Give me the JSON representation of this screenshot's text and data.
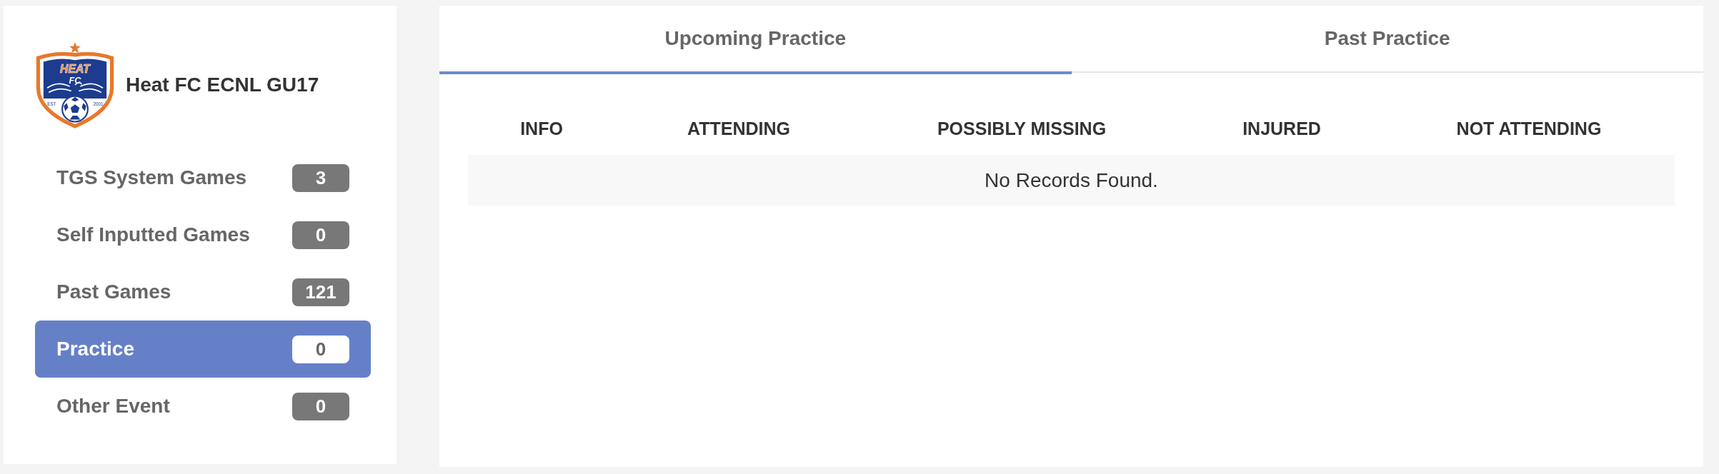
{
  "sidebar": {
    "team": {
      "logo": {
        "wordmark": "HEAT",
        "monogram": "FC",
        "est_label": "EST",
        "est_year": "2001"
      },
      "name": "Heat FC ECNL GU17"
    },
    "items": [
      {
        "label": "TGS System Games",
        "count": "3",
        "selected": false
      },
      {
        "label": "Self Inputted Games",
        "count": "0",
        "selected": false
      },
      {
        "label": "Past Games",
        "count": "121",
        "selected": false
      },
      {
        "label": "Practice",
        "count": "0",
        "selected": true
      },
      {
        "label": "Other Event",
        "count": "0",
        "selected": false
      }
    ]
  },
  "tabs": [
    {
      "label": "Upcoming Practice",
      "selected": true
    },
    {
      "label": "Past Practice",
      "selected": false
    }
  ],
  "table": {
    "columns": [
      "INFO",
      "ATTENDING",
      "POSSIBLY MISSING",
      "INJURED",
      "NOT ATTENDING"
    ],
    "empty_message": "No Records Found."
  }
}
